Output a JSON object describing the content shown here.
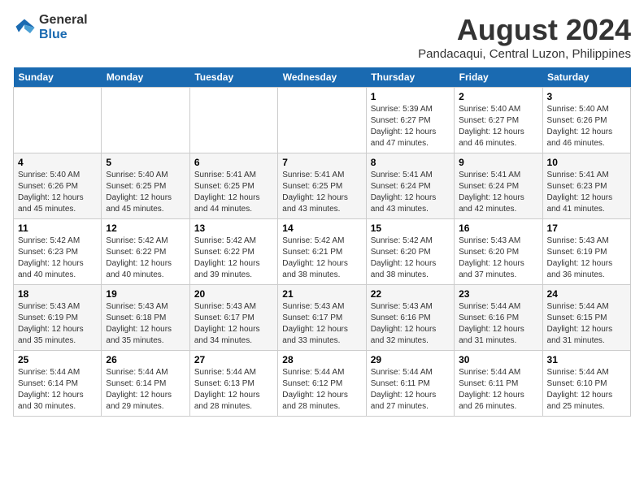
{
  "logo": {
    "line1": "General",
    "line2": "Blue"
  },
  "title": "August 2024",
  "subtitle": "Pandacaqui, Central Luzon, Philippines",
  "weekdays": [
    "Sunday",
    "Monday",
    "Tuesday",
    "Wednesday",
    "Thursday",
    "Friday",
    "Saturday"
  ],
  "weeks": [
    [
      {
        "day": "",
        "info": ""
      },
      {
        "day": "",
        "info": ""
      },
      {
        "day": "",
        "info": ""
      },
      {
        "day": "",
        "info": ""
      },
      {
        "day": "1",
        "info": "Sunrise: 5:39 AM\nSunset: 6:27 PM\nDaylight: 12 hours\nand 47 minutes."
      },
      {
        "day": "2",
        "info": "Sunrise: 5:40 AM\nSunset: 6:27 PM\nDaylight: 12 hours\nand 46 minutes."
      },
      {
        "day": "3",
        "info": "Sunrise: 5:40 AM\nSunset: 6:26 PM\nDaylight: 12 hours\nand 46 minutes."
      }
    ],
    [
      {
        "day": "4",
        "info": "Sunrise: 5:40 AM\nSunset: 6:26 PM\nDaylight: 12 hours\nand 45 minutes."
      },
      {
        "day": "5",
        "info": "Sunrise: 5:40 AM\nSunset: 6:25 PM\nDaylight: 12 hours\nand 45 minutes."
      },
      {
        "day": "6",
        "info": "Sunrise: 5:41 AM\nSunset: 6:25 PM\nDaylight: 12 hours\nand 44 minutes."
      },
      {
        "day": "7",
        "info": "Sunrise: 5:41 AM\nSunset: 6:25 PM\nDaylight: 12 hours\nand 43 minutes."
      },
      {
        "day": "8",
        "info": "Sunrise: 5:41 AM\nSunset: 6:24 PM\nDaylight: 12 hours\nand 43 minutes."
      },
      {
        "day": "9",
        "info": "Sunrise: 5:41 AM\nSunset: 6:24 PM\nDaylight: 12 hours\nand 42 minutes."
      },
      {
        "day": "10",
        "info": "Sunrise: 5:41 AM\nSunset: 6:23 PM\nDaylight: 12 hours\nand 41 minutes."
      }
    ],
    [
      {
        "day": "11",
        "info": "Sunrise: 5:42 AM\nSunset: 6:23 PM\nDaylight: 12 hours\nand 40 minutes."
      },
      {
        "day": "12",
        "info": "Sunrise: 5:42 AM\nSunset: 6:22 PM\nDaylight: 12 hours\nand 40 minutes."
      },
      {
        "day": "13",
        "info": "Sunrise: 5:42 AM\nSunset: 6:22 PM\nDaylight: 12 hours\nand 39 minutes."
      },
      {
        "day": "14",
        "info": "Sunrise: 5:42 AM\nSunset: 6:21 PM\nDaylight: 12 hours\nand 38 minutes."
      },
      {
        "day": "15",
        "info": "Sunrise: 5:42 AM\nSunset: 6:20 PM\nDaylight: 12 hours\nand 38 minutes."
      },
      {
        "day": "16",
        "info": "Sunrise: 5:43 AM\nSunset: 6:20 PM\nDaylight: 12 hours\nand 37 minutes."
      },
      {
        "day": "17",
        "info": "Sunrise: 5:43 AM\nSunset: 6:19 PM\nDaylight: 12 hours\nand 36 minutes."
      }
    ],
    [
      {
        "day": "18",
        "info": "Sunrise: 5:43 AM\nSunset: 6:19 PM\nDaylight: 12 hours\nand 35 minutes."
      },
      {
        "day": "19",
        "info": "Sunrise: 5:43 AM\nSunset: 6:18 PM\nDaylight: 12 hours\nand 35 minutes."
      },
      {
        "day": "20",
        "info": "Sunrise: 5:43 AM\nSunset: 6:17 PM\nDaylight: 12 hours\nand 34 minutes."
      },
      {
        "day": "21",
        "info": "Sunrise: 5:43 AM\nSunset: 6:17 PM\nDaylight: 12 hours\nand 33 minutes."
      },
      {
        "day": "22",
        "info": "Sunrise: 5:43 AM\nSunset: 6:16 PM\nDaylight: 12 hours\nand 32 minutes."
      },
      {
        "day": "23",
        "info": "Sunrise: 5:44 AM\nSunset: 6:16 PM\nDaylight: 12 hours\nand 31 minutes."
      },
      {
        "day": "24",
        "info": "Sunrise: 5:44 AM\nSunset: 6:15 PM\nDaylight: 12 hours\nand 31 minutes."
      }
    ],
    [
      {
        "day": "25",
        "info": "Sunrise: 5:44 AM\nSunset: 6:14 PM\nDaylight: 12 hours\nand 30 minutes."
      },
      {
        "day": "26",
        "info": "Sunrise: 5:44 AM\nSunset: 6:14 PM\nDaylight: 12 hours\nand 29 minutes."
      },
      {
        "day": "27",
        "info": "Sunrise: 5:44 AM\nSunset: 6:13 PM\nDaylight: 12 hours\nand 28 minutes."
      },
      {
        "day": "28",
        "info": "Sunrise: 5:44 AM\nSunset: 6:12 PM\nDaylight: 12 hours\nand 28 minutes."
      },
      {
        "day": "29",
        "info": "Sunrise: 5:44 AM\nSunset: 6:11 PM\nDaylight: 12 hours\nand 27 minutes."
      },
      {
        "day": "30",
        "info": "Sunrise: 5:44 AM\nSunset: 6:11 PM\nDaylight: 12 hours\nand 26 minutes."
      },
      {
        "day": "31",
        "info": "Sunrise: 5:44 AM\nSunset: 6:10 PM\nDaylight: 12 hours\nand 25 minutes."
      }
    ]
  ]
}
